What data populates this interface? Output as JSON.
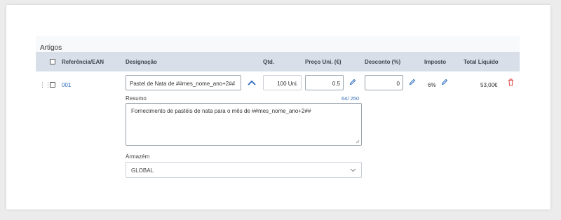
{
  "section": {
    "title": "Artigos"
  },
  "table": {
    "headers": {
      "reference": "Referência/EAN",
      "designation": "Designação",
      "qty": "Qtd.",
      "unit_price": "Preço Uni. (€)",
      "discount": "Desconto (%)",
      "tax": "Imposto",
      "total": "Total Líquido"
    }
  },
  "item": {
    "reference": "001",
    "designation": "Pastel de Nata de ##mes_nome_ano+2##",
    "qty": "100 Uni.",
    "unit_price": "0.5",
    "discount": "0",
    "tax": "6%",
    "total": "53,00€",
    "summary_label": "Resumo",
    "summary_counter": "64/ 250",
    "summary": "Fornecimento de pastéis de nata para o mês de ##mes_nome_ano+2##",
    "warehouse_label": "Armazém",
    "warehouse": "GLOBAL"
  },
  "icons": {
    "collapse": "chevron-up-icon",
    "edit": "pencil-icon",
    "delete": "trash-icon",
    "drag": "drag-handle-icon",
    "dropdown": "chevron-down-icon"
  },
  "colors": {
    "accent": "#2c6bbf",
    "danger": "#e04b4b",
    "header_bg": "#d8dfe8"
  }
}
